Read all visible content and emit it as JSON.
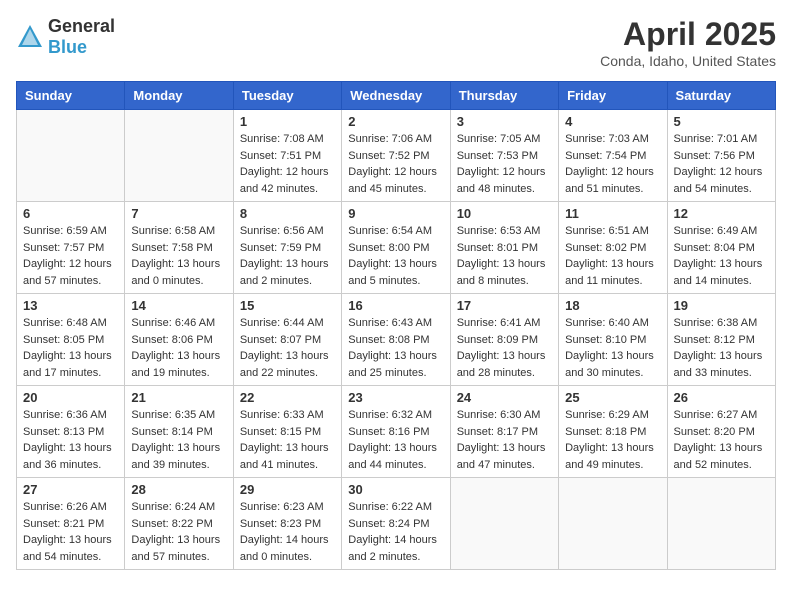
{
  "header": {
    "logo_general": "General",
    "logo_blue": "Blue",
    "month": "April 2025",
    "location": "Conda, Idaho, United States"
  },
  "days_of_week": [
    "Sunday",
    "Monday",
    "Tuesday",
    "Wednesday",
    "Thursday",
    "Friday",
    "Saturday"
  ],
  "weeks": [
    [
      {
        "day": "",
        "info": ""
      },
      {
        "day": "",
        "info": ""
      },
      {
        "day": "1",
        "info": "Sunrise: 7:08 AM\nSunset: 7:51 PM\nDaylight: 12 hours\nand 42 minutes."
      },
      {
        "day": "2",
        "info": "Sunrise: 7:06 AM\nSunset: 7:52 PM\nDaylight: 12 hours\nand 45 minutes."
      },
      {
        "day": "3",
        "info": "Sunrise: 7:05 AM\nSunset: 7:53 PM\nDaylight: 12 hours\nand 48 minutes."
      },
      {
        "day": "4",
        "info": "Sunrise: 7:03 AM\nSunset: 7:54 PM\nDaylight: 12 hours\nand 51 minutes."
      },
      {
        "day": "5",
        "info": "Sunrise: 7:01 AM\nSunset: 7:56 PM\nDaylight: 12 hours\nand 54 minutes."
      }
    ],
    [
      {
        "day": "6",
        "info": "Sunrise: 6:59 AM\nSunset: 7:57 PM\nDaylight: 12 hours\nand 57 minutes."
      },
      {
        "day": "7",
        "info": "Sunrise: 6:58 AM\nSunset: 7:58 PM\nDaylight: 13 hours\nand 0 minutes."
      },
      {
        "day": "8",
        "info": "Sunrise: 6:56 AM\nSunset: 7:59 PM\nDaylight: 13 hours\nand 2 minutes."
      },
      {
        "day": "9",
        "info": "Sunrise: 6:54 AM\nSunset: 8:00 PM\nDaylight: 13 hours\nand 5 minutes."
      },
      {
        "day": "10",
        "info": "Sunrise: 6:53 AM\nSunset: 8:01 PM\nDaylight: 13 hours\nand 8 minutes."
      },
      {
        "day": "11",
        "info": "Sunrise: 6:51 AM\nSunset: 8:02 PM\nDaylight: 13 hours\nand 11 minutes."
      },
      {
        "day": "12",
        "info": "Sunrise: 6:49 AM\nSunset: 8:04 PM\nDaylight: 13 hours\nand 14 minutes."
      }
    ],
    [
      {
        "day": "13",
        "info": "Sunrise: 6:48 AM\nSunset: 8:05 PM\nDaylight: 13 hours\nand 17 minutes."
      },
      {
        "day": "14",
        "info": "Sunrise: 6:46 AM\nSunset: 8:06 PM\nDaylight: 13 hours\nand 19 minutes."
      },
      {
        "day": "15",
        "info": "Sunrise: 6:44 AM\nSunset: 8:07 PM\nDaylight: 13 hours\nand 22 minutes."
      },
      {
        "day": "16",
        "info": "Sunrise: 6:43 AM\nSunset: 8:08 PM\nDaylight: 13 hours\nand 25 minutes."
      },
      {
        "day": "17",
        "info": "Sunrise: 6:41 AM\nSunset: 8:09 PM\nDaylight: 13 hours\nand 28 minutes."
      },
      {
        "day": "18",
        "info": "Sunrise: 6:40 AM\nSunset: 8:10 PM\nDaylight: 13 hours\nand 30 minutes."
      },
      {
        "day": "19",
        "info": "Sunrise: 6:38 AM\nSunset: 8:12 PM\nDaylight: 13 hours\nand 33 minutes."
      }
    ],
    [
      {
        "day": "20",
        "info": "Sunrise: 6:36 AM\nSunset: 8:13 PM\nDaylight: 13 hours\nand 36 minutes."
      },
      {
        "day": "21",
        "info": "Sunrise: 6:35 AM\nSunset: 8:14 PM\nDaylight: 13 hours\nand 39 minutes."
      },
      {
        "day": "22",
        "info": "Sunrise: 6:33 AM\nSunset: 8:15 PM\nDaylight: 13 hours\nand 41 minutes."
      },
      {
        "day": "23",
        "info": "Sunrise: 6:32 AM\nSunset: 8:16 PM\nDaylight: 13 hours\nand 44 minutes."
      },
      {
        "day": "24",
        "info": "Sunrise: 6:30 AM\nSunset: 8:17 PM\nDaylight: 13 hours\nand 47 minutes."
      },
      {
        "day": "25",
        "info": "Sunrise: 6:29 AM\nSunset: 8:18 PM\nDaylight: 13 hours\nand 49 minutes."
      },
      {
        "day": "26",
        "info": "Sunrise: 6:27 AM\nSunset: 8:20 PM\nDaylight: 13 hours\nand 52 minutes."
      }
    ],
    [
      {
        "day": "27",
        "info": "Sunrise: 6:26 AM\nSunset: 8:21 PM\nDaylight: 13 hours\nand 54 minutes."
      },
      {
        "day": "28",
        "info": "Sunrise: 6:24 AM\nSunset: 8:22 PM\nDaylight: 13 hours\nand 57 minutes."
      },
      {
        "day": "29",
        "info": "Sunrise: 6:23 AM\nSunset: 8:23 PM\nDaylight: 14 hours\nand 0 minutes."
      },
      {
        "day": "30",
        "info": "Sunrise: 6:22 AM\nSunset: 8:24 PM\nDaylight: 14 hours\nand 2 minutes."
      },
      {
        "day": "",
        "info": ""
      },
      {
        "day": "",
        "info": ""
      },
      {
        "day": "",
        "info": ""
      }
    ]
  ]
}
